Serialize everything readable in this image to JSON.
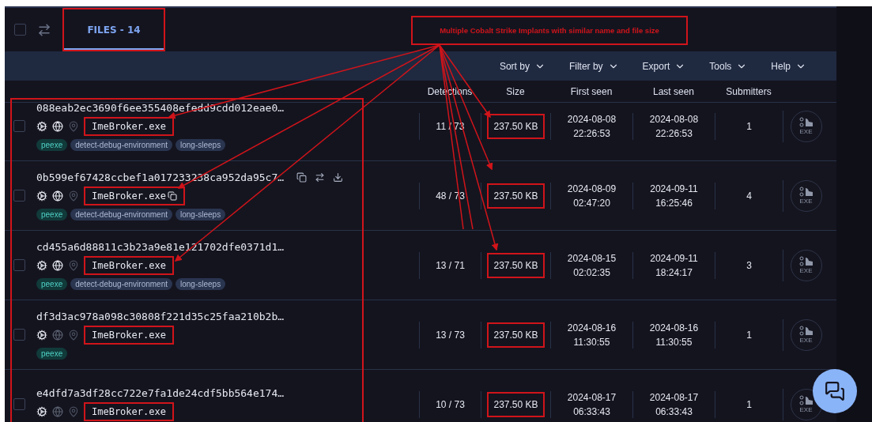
{
  "select_all": {
    "checked": false
  },
  "tabs": [
    {
      "label": "FILES - 14",
      "selected": true,
      "highlighted": true
    }
  ],
  "annotation": {
    "text": "Multiple Cobalt Strike Implants with similar name and file size"
  },
  "menu": [
    {
      "label": "Sort by"
    },
    {
      "label": "Filter by"
    },
    {
      "label": "Export"
    },
    {
      "label": "Tools"
    },
    {
      "label": "Help"
    }
  ],
  "columns": [
    "Detections",
    "Size",
    "First seen",
    "Last seen",
    "Submitters"
  ],
  "rows": [
    {
      "hash": "088eab2ec3690f6ee355408efedd9cdd012eae0…",
      "name": "ImeBroker.exe",
      "online": true,
      "hovered": false,
      "tags": [
        {
          "label": "peexe",
          "kind": "type"
        },
        {
          "label": "detect-debug-environment",
          "kind": "behavior"
        },
        {
          "label": "long-sleeps",
          "kind": "behavior"
        }
      ],
      "detections": "11 / 73",
      "size": "237.50 KB",
      "first_seen": [
        "2024-08-08",
        "22:26:53"
      ],
      "last_seen": [
        "2024-08-08",
        "22:26:53"
      ],
      "submitters": "1",
      "file_type": "EXE",
      "name_highlighted": true,
      "size_highlighted": true,
      "checked": false
    },
    {
      "hash": "0b599ef67428ccbef1a017233238ca952da95c7…",
      "name": "ImeBroker.exe",
      "online": true,
      "hovered": true,
      "tags": [
        {
          "label": "peexe",
          "kind": "type"
        },
        {
          "label": "detect-debug-environment",
          "kind": "behavior"
        },
        {
          "label": "long-sleeps",
          "kind": "behavior"
        }
      ],
      "detections": "48 / 73",
      "size": "237.50 KB",
      "first_seen": [
        "2024-08-09",
        "02:47:20"
      ],
      "last_seen": [
        "2024-09-11",
        "16:25:46"
      ],
      "submitters": "4",
      "file_type": "EXE",
      "name_highlighted": true,
      "size_highlighted": true,
      "checked": false
    },
    {
      "hash": "cd455a6d88811c3b23a9e81e121702dfe0371d1…",
      "name": "ImeBroker.exe",
      "online": true,
      "hovered": false,
      "tags": [
        {
          "label": "peexe",
          "kind": "type"
        },
        {
          "label": "detect-debug-environment",
          "kind": "behavior"
        },
        {
          "label": "long-sleeps",
          "kind": "behavior"
        }
      ],
      "detections": "13 / 71",
      "size": "237.50 KB",
      "first_seen": [
        "2024-08-15",
        "02:02:35"
      ],
      "last_seen": [
        "2024-09-11",
        "18:24:17"
      ],
      "submitters": "3",
      "file_type": "EXE",
      "name_highlighted": true,
      "size_highlighted": true,
      "checked": false
    },
    {
      "hash": "df3d3ac978a098c30808f221d35c25faa210b2b…",
      "name": "ImeBroker.exe",
      "online": false,
      "hovered": false,
      "tags": [
        {
          "label": "peexe",
          "kind": "type"
        }
      ],
      "detections": "13 / 73",
      "size": "237.50 KB",
      "first_seen": [
        "2024-08-16",
        "11:30:55"
      ],
      "last_seen": [
        "2024-08-16",
        "11:30:55"
      ],
      "submitters": "1",
      "file_type": "EXE",
      "name_highlighted": true,
      "size_highlighted": true,
      "checked": false
    },
    {
      "hash": "e4dfd7a3df28cc722e7fa1de24cdf5bb564e174…",
      "name": "ImeBroker.exe",
      "online": false,
      "hovered": false,
      "tags": [],
      "detections": "10 / 73",
      "size": "237.50 KB",
      "first_seen": [
        "2024-08-17",
        "06:33:43"
      ],
      "last_seen": [
        "2024-08-17",
        "06:33:43"
      ],
      "submitters": "1",
      "file_type": "EXE",
      "name_highlighted": true,
      "size_highlighted": true,
      "checked": false
    }
  ]
}
